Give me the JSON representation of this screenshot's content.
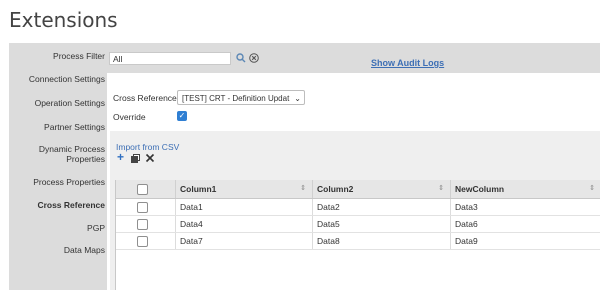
{
  "page": {
    "title": "Extensions"
  },
  "sidebar": {
    "items": [
      {
        "label": "Process Filter"
      },
      {
        "label": "Connection Settings"
      },
      {
        "label": "Operation Settings"
      },
      {
        "label": "Partner Settings"
      },
      {
        "label": "Dynamic Process Properties"
      },
      {
        "label": "Process Properties"
      },
      {
        "label": "Cross Reference",
        "active": true
      },
      {
        "label": "PGP"
      },
      {
        "label": "Data Maps"
      }
    ]
  },
  "filter": {
    "value": "All",
    "search_icon": "search-icon",
    "clear_icon": "clear-icon"
  },
  "audit_link": "Show Audit Logs",
  "cross_reference": {
    "label": "Cross Reference",
    "selected": "[TEST] CRT - Definition Updat",
    "override_label": "Override",
    "override_checked": true
  },
  "csv": {
    "import_label": "Import from CSV",
    "toolbar": [
      {
        "icon": "add-icon"
      },
      {
        "icon": "copy-icon"
      },
      {
        "icon": "delete-icon"
      }
    ]
  },
  "table": {
    "columns": [
      "Column1",
      "Column2",
      "NewColumn"
    ],
    "rows": [
      [
        "Data1",
        "Data2",
        "Data3"
      ],
      [
        "Data4",
        "Data5",
        "Data6"
      ],
      [
        "Data7",
        "Data8",
        "Data9"
      ]
    ]
  },
  "colors": {
    "accent": "#3d6fb5",
    "checkbox": "#2f7fd3",
    "panel_bg": "#dcdcdc"
  }
}
